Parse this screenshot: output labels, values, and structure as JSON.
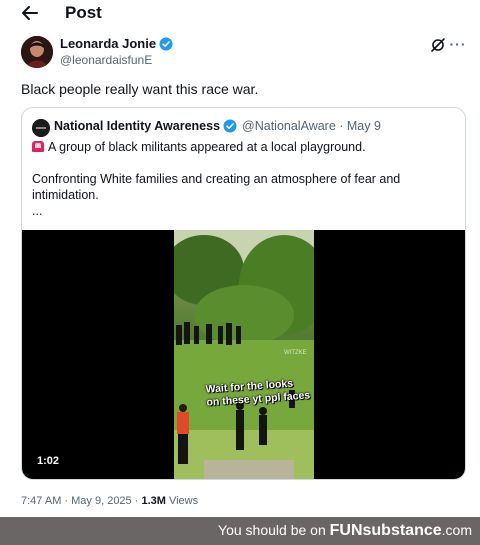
{
  "header": {
    "title": "Post",
    "back_icon": "back-arrow-icon"
  },
  "post": {
    "author_name": "Leonarda Jonie",
    "author_handle": "@leonardaisfunE",
    "verified_color": "#1d9bf0",
    "text": "Black people really want this race war.",
    "timestamp": "7:47 AM · May 9, 2025 · ",
    "views_count": "1.3M",
    "views_label": " Views"
  },
  "quote": {
    "author_name": "National Identity Awareness",
    "author_handle": "@NationalAware · May 9",
    "line1": "A group of black militants appeared at a local playground.",
    "line2": "Confronting White families and creating an atmosphere of fear and intimidation.",
    "line3": "...",
    "video": {
      "caption_line1": "Wait for the looks",
      "caption_line2": "on these yt ppl faces",
      "watermark": "WITZKE",
      "duration": "1:02"
    }
  },
  "footer": {
    "prefix": "You should be on ",
    "brand": "FUNsubstance",
    "suffix": ".com"
  }
}
